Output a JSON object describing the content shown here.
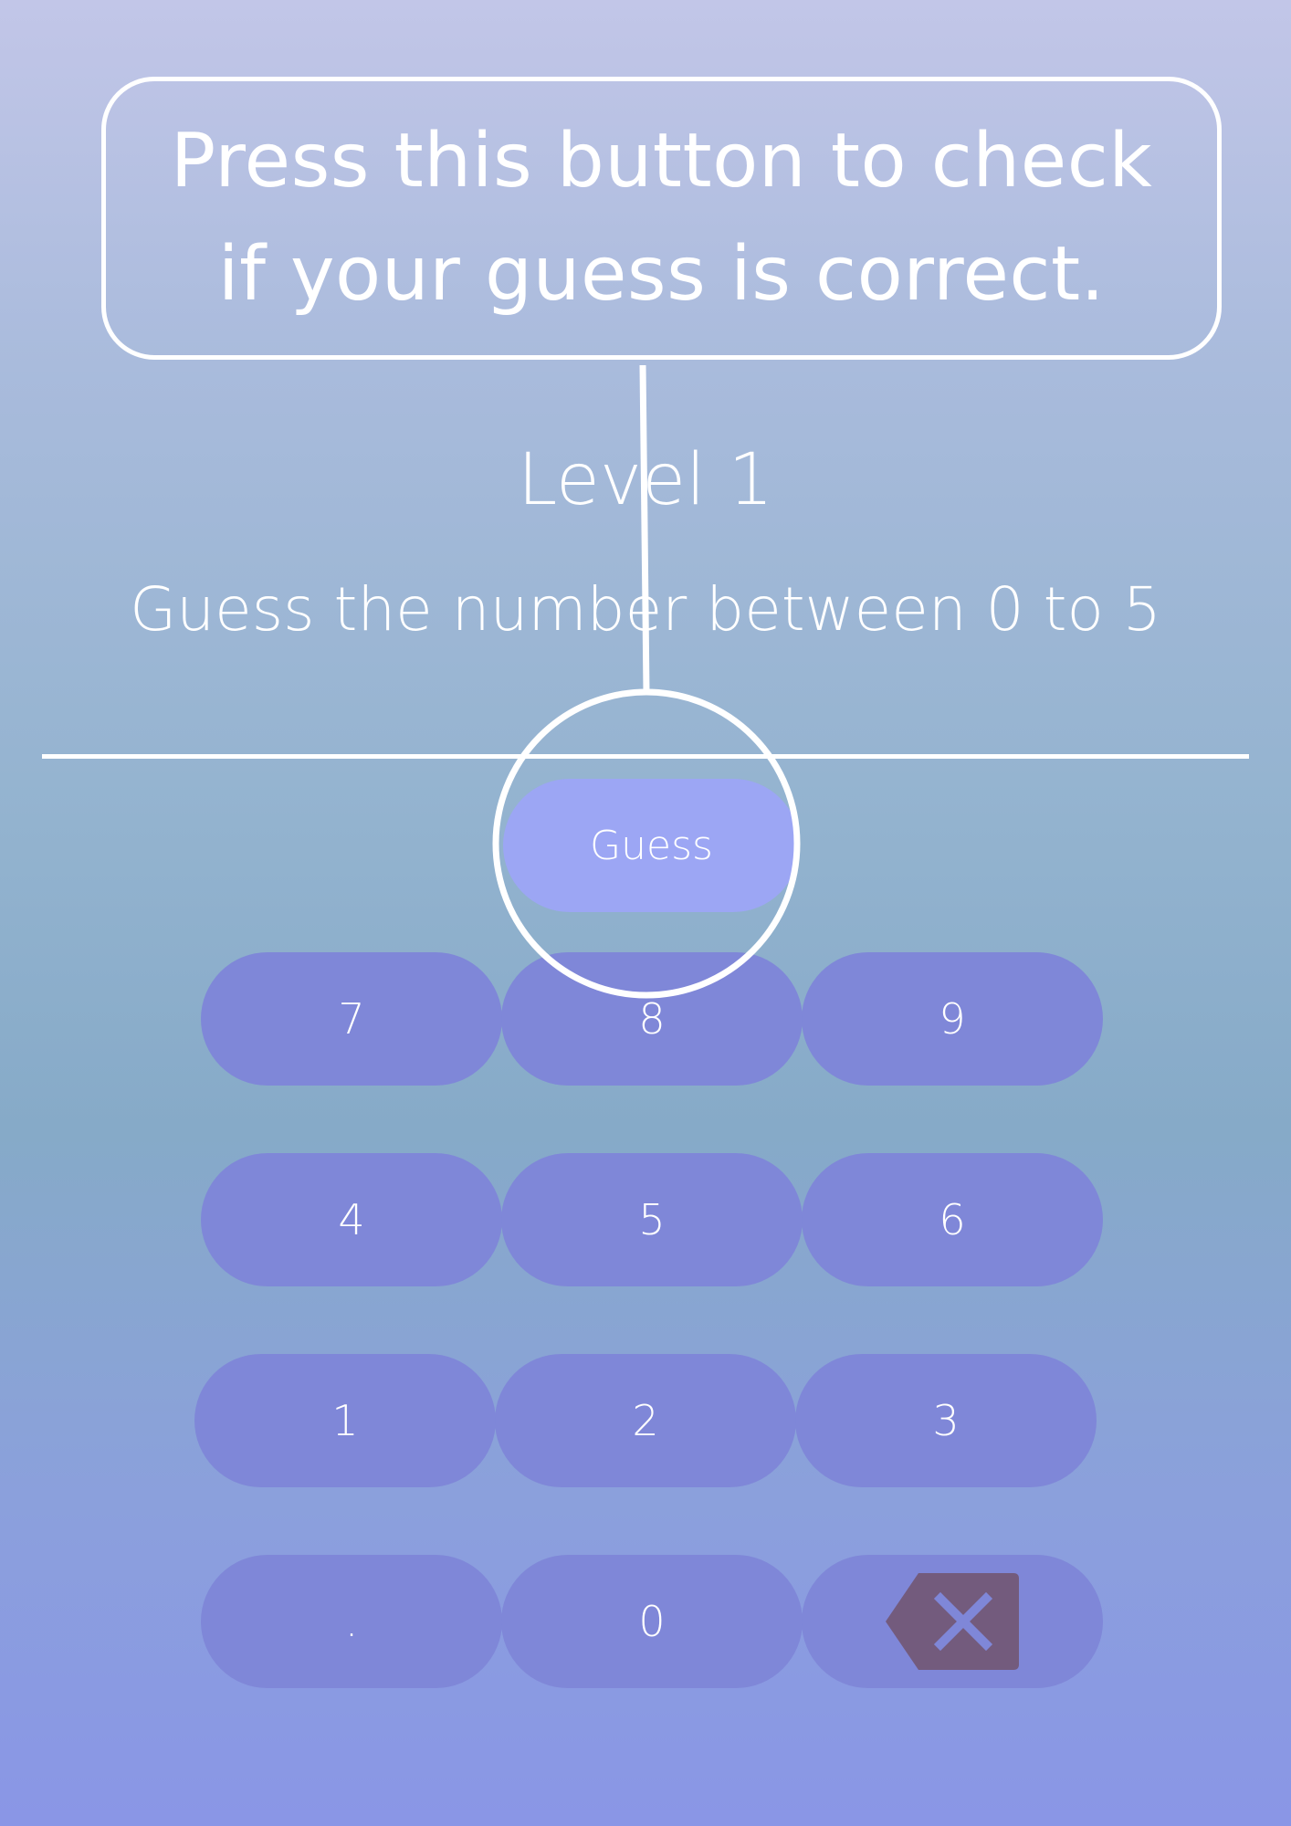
{
  "tooltip": {
    "line1": "Press this button to check",
    "line2": "if your guess is correct."
  },
  "game": {
    "level_title": "Level 1",
    "instruction": "Guess the number between 0 to 5",
    "guess_label": "Guess"
  },
  "keypad": {
    "keys": [
      "7",
      "8",
      "9",
      "4",
      "5",
      "6",
      "1",
      "2",
      "3",
      ".",
      "0"
    ],
    "backspace_icon": "backspace-icon"
  },
  "colors": {
    "key_bg": "#7f87d8",
    "guess_bg": "#9ca6f4",
    "backspace_icon": "#735b7d",
    "highlight": "#ffffff"
  }
}
